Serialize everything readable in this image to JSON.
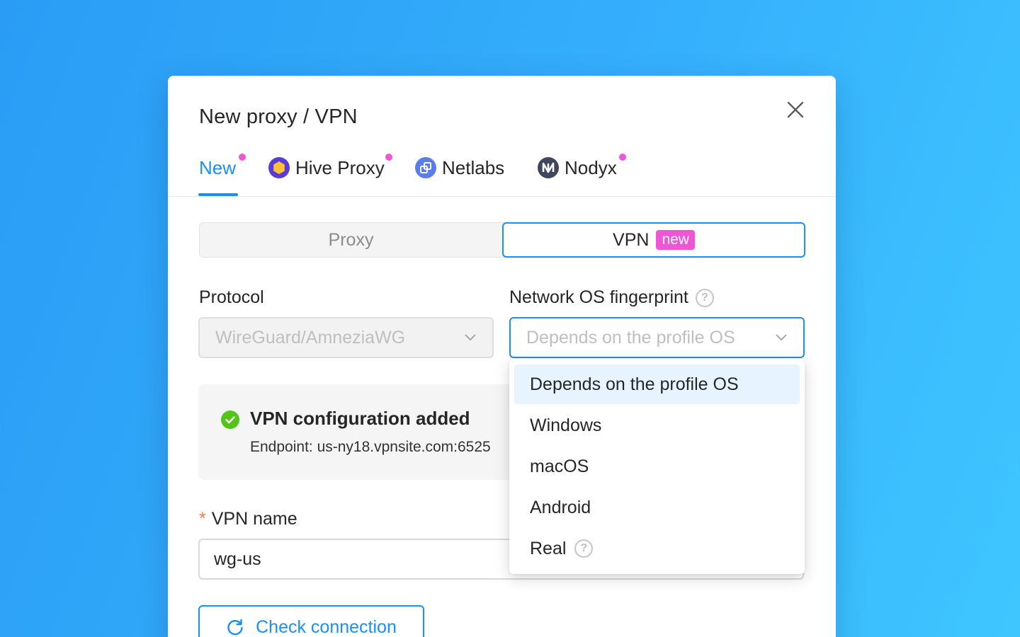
{
  "dialog": {
    "title": "New proxy / VPN",
    "tabs": [
      {
        "label": "New",
        "active": true,
        "has_dot": true
      },
      {
        "label": "Hive Proxy",
        "icon": "hive-proxy-icon",
        "has_dot": true
      },
      {
        "label": "Netlabs",
        "icon": "netlabs-icon",
        "has_dot": false
      },
      {
        "label": "Nodyx",
        "icon": "nodyx-icon",
        "has_dot": true
      }
    ]
  },
  "type_switch": {
    "proxy_label": "Proxy",
    "vpn_label": "VPN",
    "vpn_badge": "new",
    "selected": "VPN"
  },
  "protocol": {
    "label": "Protocol",
    "value": "WireGuard/AmneziaWG",
    "disabled": true
  },
  "fingerprint": {
    "label": "Network OS fingerprint",
    "placeholder": "Depends on the profile OS",
    "options": [
      {
        "label": "Depends on the profile OS",
        "selected": true
      },
      {
        "label": "Windows"
      },
      {
        "label": "macOS"
      },
      {
        "label": "Android"
      },
      {
        "label": "Real",
        "has_help": true
      }
    ]
  },
  "notice": {
    "title": "VPN configuration added",
    "subtitle": "Endpoint: us-ny18.vpnsite.com:6525",
    "status": "success"
  },
  "vpn_name": {
    "required_mark": "*",
    "label": "VPN name",
    "value": "wg-us"
  },
  "actions": {
    "check_connection": "Check connection"
  },
  "colors": {
    "accent": "#1a8ff5",
    "badge": "#ef55d6",
    "success": "#52c41a",
    "background": "#35b0fc"
  }
}
